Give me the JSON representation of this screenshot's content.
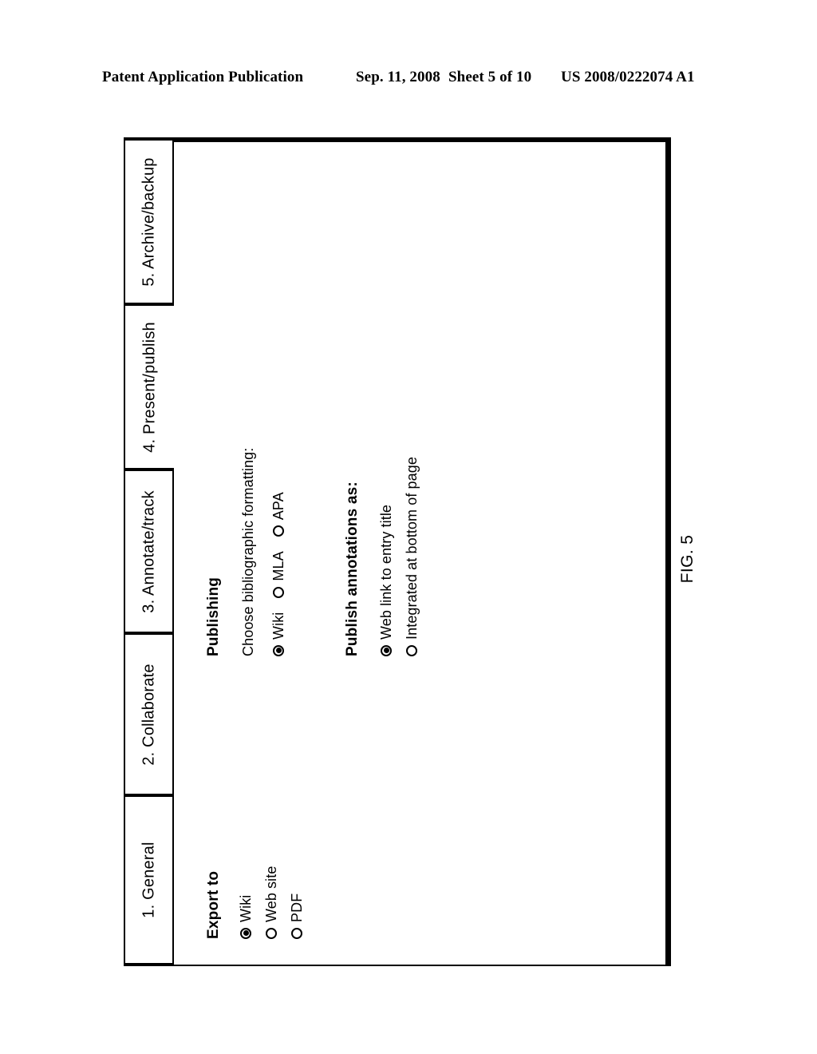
{
  "header": {
    "publication": "Patent Application Publication",
    "date": "Sep. 11, 2008",
    "sheet": "Sheet 5 of 10",
    "patent_number": "US 2008/0222074 A1"
  },
  "figure": {
    "caption": "FIG. 5",
    "tabs": [
      {
        "label": "1. General"
      },
      {
        "label": "2. Collaborate"
      },
      {
        "label": "3. Annotate/track"
      },
      {
        "label": "4. Present/publish"
      },
      {
        "label": "5. Archive/backup"
      }
    ],
    "panel": {
      "groups": [
        {
          "title": "Export to",
          "options": [
            {
              "label": "Wiki",
              "selected": true
            },
            {
              "label": "Web site",
              "selected": false
            },
            {
              "label": "PDF",
              "selected": false
            }
          ]
        },
        {
          "title": "Publishing",
          "subtitle": "Choose bibliographic formatting:",
          "options": [
            {
              "label": "Wiki",
              "selected": true
            },
            {
              "label": "MLA",
              "selected": false
            },
            {
              "label": "APA",
              "selected": false
            }
          ]
        },
        {
          "title": "Publish annotations as:",
          "options": [
            {
              "label": "Web link to entry title",
              "selected": true
            },
            {
              "label": "Integrated at bottom of page",
              "selected": false
            }
          ]
        }
      ]
    }
  },
  "colors": {
    "ink": "#000000",
    "paper": "#ffffff"
  }
}
